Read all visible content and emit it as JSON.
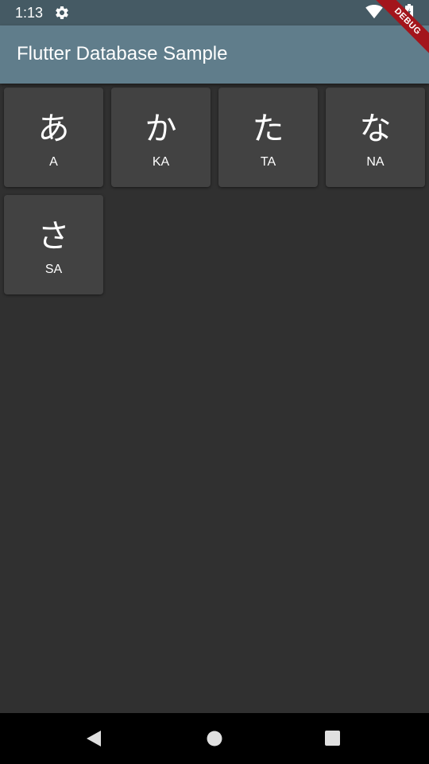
{
  "status_bar": {
    "time": "1:13",
    "icons": [
      "gear-icon",
      "wifi-icon",
      "battery-icon"
    ]
  },
  "app_bar": {
    "title": "Flutter Database Sample",
    "debug_banner": "DEBUG"
  },
  "cards": [
    {
      "character": "あ",
      "romaji": "A"
    },
    {
      "character": "か",
      "romaji": "KA"
    },
    {
      "character": "た",
      "romaji": "TA"
    },
    {
      "character": "な",
      "romaji": "NA"
    },
    {
      "character": "さ",
      "romaji": "SA"
    }
  ],
  "nav_bar": {
    "buttons": [
      "back-icon",
      "home-icon",
      "recents-icon"
    ]
  },
  "colors": {
    "status_bar": "#455a64",
    "app_bar": "#607d8b",
    "background": "#303030",
    "card": "#424242",
    "debug_banner": "#a3151c"
  }
}
